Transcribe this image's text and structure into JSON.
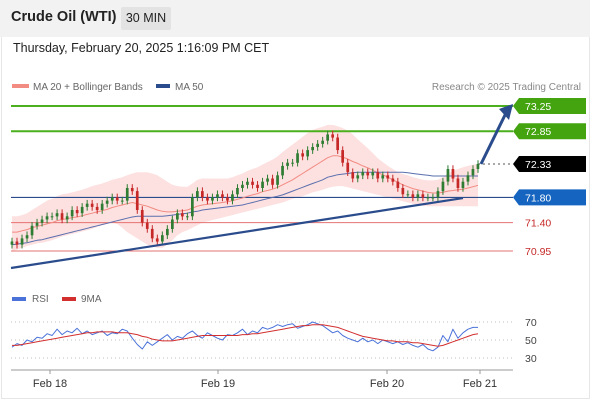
{
  "header": {
    "instrument": "Crude Oil (WTI)",
    "timeframe": "30 MIN",
    "timestamp": "Thursday, February 20, 2025 1:16:09 PM CET"
  },
  "legend": {
    "items": [
      {
        "label": "MA 20 + Bollinger Bands",
        "color": "#f28b82"
      },
      {
        "label": "MA 50",
        "color": "#2b4c8c"
      }
    ],
    "credit": "Research © 2025 Trading Central"
  },
  "colors": {
    "up": "#2e7d32",
    "down": "#c62828",
    "trend": "#2b4c8c",
    "resistance": "#4caf1e",
    "support": "#e57373",
    "pivot_bg": "#1565c0",
    "current_bg": "#000000",
    "bands": "#fcd6d6",
    "rsi": "#4a72d9",
    "rsi_ma": "#d32f2f"
  },
  "chart_data": [
    {
      "type": "candlestick",
      "title": "",
      "xlabel": "",
      "ylabel": "",
      "ylim": [
        70.7,
        73.4
      ],
      "x_ticks": [
        "Feb 18",
        "Feb 19",
        "Feb 20",
        "Feb 21"
      ],
      "grid": false,
      "levels": [
        {
          "label": "73.25",
          "value": 73.25,
          "kind": "resistance"
        },
        {
          "label": "72.85",
          "value": 72.85,
          "kind": "resistance"
        },
        {
          "label": "72.33",
          "value": 72.33,
          "kind": "current"
        },
        {
          "label": "71.80",
          "value": 71.8,
          "kind": "pivot"
        },
        {
          "label": "71.40",
          "value": 71.4,
          "kind": "support"
        },
        {
          "label": "70.95",
          "value": 70.95,
          "kind": "support"
        }
      ],
      "close_series": [
        71.1,
        71.05,
        71.15,
        71.2,
        71.35,
        71.4,
        71.45,
        71.5,
        71.5,
        71.55,
        71.45,
        71.5,
        71.6,
        71.55,
        71.65,
        71.7,
        71.65,
        71.6,
        71.7,
        71.75,
        71.8,
        71.75,
        71.75,
        71.95,
        71.9,
        71.6,
        71.4,
        71.3,
        71.15,
        71.1,
        71.2,
        71.3,
        71.45,
        71.55,
        71.5,
        71.5,
        71.8,
        71.9,
        71.8,
        71.75,
        71.8,
        71.85,
        71.8,
        71.75,
        71.85,
        71.95,
        72.0,
        72.05,
        72.0,
        71.95,
        72.05,
        72.1,
        72.0,
        72.15,
        72.3,
        72.35,
        72.35,
        72.5,
        72.45,
        72.55,
        72.6,
        72.65,
        72.7,
        72.8,
        72.75,
        72.55,
        72.35,
        72.2,
        72.1,
        72.15,
        72.2,
        72.15,
        72.2,
        72.1,
        72.15,
        72.1,
        72.05,
        71.95,
        71.85,
        71.85,
        71.8,
        71.85,
        71.8,
        71.8,
        71.8,
        71.9,
        72.05,
        72.25,
        72.1,
        71.95,
        72.05,
        72.15,
        72.25,
        72.33
      ],
      "ma20": [
        71.25,
        71.25,
        71.27,
        71.29,
        71.32,
        71.34,
        71.36,
        71.38,
        71.4,
        71.43,
        71.45,
        71.46,
        71.48,
        71.49,
        71.51,
        71.53,
        71.55,
        71.57,
        71.59,
        71.61,
        71.64,
        71.66,
        71.68,
        71.7,
        71.72,
        71.7,
        71.68,
        71.66,
        71.63,
        71.6,
        71.58,
        71.57,
        71.57,
        71.58,
        71.59,
        71.6,
        71.63,
        71.66,
        71.68,
        71.69,
        71.7,
        71.71,
        71.72,
        71.73,
        71.75,
        71.77,
        71.79,
        71.82,
        71.84,
        71.86,
        71.89,
        71.91,
        71.93,
        71.96,
        72.0,
        72.04,
        72.08,
        72.13,
        72.18,
        72.23,
        72.28,
        72.33,
        72.38,
        72.43,
        72.46,
        72.46,
        72.44,
        72.41,
        72.37,
        72.34,
        72.3,
        72.27,
        72.23,
        72.19,
        72.16,
        72.12,
        72.08,
        72.04,
        72.0,
        71.97,
        71.94,
        71.92,
        71.9,
        71.88,
        71.87,
        71.87,
        71.88,
        71.9,
        71.91,
        71.92,
        71.93,
        71.95,
        71.97,
        71.99
      ],
      "bb_upper": [
        71.5,
        71.5,
        71.52,
        71.55,
        71.6,
        71.65,
        71.7,
        71.75,
        71.78,
        71.82,
        71.85,
        71.86,
        71.88,
        71.9,
        71.92,
        71.95,
        71.98,
        72.0,
        72.02,
        72.05,
        72.08,
        72.1,
        72.12,
        72.15,
        72.18,
        72.2,
        72.2,
        72.2,
        72.18,
        72.15,
        72.1,
        72.05,
        72.0,
        71.98,
        71.97,
        71.97,
        72.02,
        72.08,
        72.1,
        72.1,
        72.1,
        72.1,
        72.1,
        72.1,
        72.12,
        72.15,
        72.18,
        72.22,
        72.25,
        72.28,
        72.32,
        72.36,
        72.4,
        72.45,
        72.52,
        72.58,
        72.64,
        72.7,
        72.76,
        72.82,
        72.87,
        72.9,
        72.92,
        72.95,
        72.95,
        72.93,
        72.9,
        72.86,
        72.8,
        72.72,
        72.65,
        72.58,
        72.5,
        72.42,
        72.36,
        72.3,
        72.25,
        72.2,
        72.17,
        72.15,
        72.12,
        72.1,
        72.08,
        72.07,
        72.07,
        72.08,
        72.12,
        72.18,
        72.22,
        72.25,
        72.28,
        72.3,
        72.32,
        72.33
      ],
      "bb_lower": [
        70.95,
        70.97,
        71.0,
        71.03,
        71.05,
        71.07,
        71.08,
        71.1,
        71.12,
        71.15,
        71.18,
        71.2,
        71.22,
        71.24,
        71.26,
        71.28,
        71.3,
        71.33,
        71.36,
        71.38,
        71.4,
        71.38,
        71.32,
        71.25,
        71.2,
        71.15,
        71.1,
        71.05,
        71.02,
        71.0,
        71.0,
        71.05,
        71.12,
        71.2,
        71.25,
        71.28,
        71.32,
        71.36,
        71.4,
        71.42,
        71.44,
        71.46,
        71.48,
        71.5,
        71.52,
        71.54,
        71.56,
        71.58,
        71.6,
        71.62,
        71.64,
        71.66,
        71.68,
        71.7,
        71.72,
        71.75,
        71.78,
        71.8,
        71.82,
        71.85,
        71.88,
        71.9,
        71.92,
        71.95,
        71.97,
        71.98,
        71.98,
        71.96,
        71.94,
        71.92,
        71.9,
        71.88,
        71.86,
        71.84,
        71.82,
        71.8,
        71.78,
        71.76,
        71.74,
        71.72,
        71.7,
        71.68,
        71.67,
        71.66,
        71.66,
        71.66,
        71.66,
        71.66,
        71.66,
        71.66,
        71.66,
        71.66,
        71.66,
        71.66
      ],
      "ma50": [
        71.05,
        71.06,
        71.07,
        71.08,
        71.1,
        71.12,
        71.13,
        71.15,
        71.17,
        71.19,
        71.21,
        71.23,
        71.25,
        71.27,
        71.29,
        71.31,
        71.33,
        71.35,
        71.37,
        71.39,
        71.41,
        71.43,
        71.45,
        71.47,
        71.49,
        71.5,
        71.5,
        71.5,
        71.5,
        71.5,
        71.5,
        71.51,
        71.52,
        71.53,
        71.54,
        71.55,
        71.57,
        71.58,
        71.6,
        71.61,
        71.62,
        71.63,
        71.64,
        71.65,
        71.66,
        71.67,
        71.68,
        71.7,
        71.72,
        71.74,
        71.76,
        71.78,
        71.8,
        71.82,
        71.84,
        71.87,
        71.9,
        71.93,
        71.96,
        71.99,
        72.02,
        72.05,
        72.08,
        72.12,
        72.14,
        72.16,
        72.17,
        72.18,
        72.19,
        72.2,
        72.2,
        72.2,
        72.2,
        72.2,
        72.2,
        72.2,
        72.2,
        72.2,
        72.2,
        72.19,
        72.18,
        72.17,
        72.16,
        72.15,
        72.14,
        72.14,
        72.14,
        72.14,
        72.14,
        72.14,
        72.14,
        72.14,
        72.14,
        72.14
      ],
      "trendline": {
        "from": 70.68,
        "to": 71.79
      },
      "forecast_arrow": {
        "from": 72.33,
        "to": 73.25
      }
    },
    {
      "type": "line",
      "title": "",
      "legend": [
        "RSI",
        "9MA"
      ],
      "ylim": [
        20,
        80
      ],
      "y_ticks": [
        70,
        50,
        30
      ],
      "series": [
        {
          "name": "RSI",
          "values": [
            42,
            46,
            44,
            50,
            48,
            53,
            52,
            57,
            55,
            62,
            56,
            60,
            58,
            63,
            57,
            60,
            56,
            58,
            60,
            55,
            58,
            57,
            62,
            60,
            52,
            45,
            40,
            48,
            44,
            48,
            52,
            56,
            50,
            54,
            52,
            57,
            60,
            55,
            52,
            58,
            55,
            52,
            50,
            56,
            55,
            58,
            62,
            56,
            60,
            58,
            64,
            62,
            64,
            67,
            65,
            67,
            68,
            63,
            65,
            67,
            70,
            68,
            66,
            62,
            58,
            60,
            55,
            52,
            50,
            48,
            52,
            48,
            50,
            46,
            50,
            48,
            46,
            48,
            45,
            47,
            44,
            42,
            45,
            40,
            38,
            42,
            55,
            48,
            62,
            52,
            58,
            62,
            64,
            64
          ]
        },
        {
          "name": "9MA",
          "values": [
            44,
            44,
            45,
            46,
            47,
            48,
            49,
            50,
            51,
            52,
            53,
            54,
            55,
            56,
            57,
            58,
            58,
            59,
            59,
            59,
            59,
            58,
            58,
            58,
            57,
            56,
            54,
            53,
            51,
            50,
            49,
            49,
            49,
            50,
            51,
            52,
            53,
            54,
            55,
            55,
            55,
            55,
            55,
            55,
            55,
            55,
            56,
            56,
            57,
            57,
            58,
            59,
            60,
            61,
            62,
            63,
            64,
            65,
            66,
            66,
            67,
            67,
            67,
            66,
            65,
            64,
            62,
            60,
            58,
            56,
            54,
            53,
            52,
            51,
            50,
            49,
            49,
            48,
            48,
            48,
            47,
            47,
            46,
            45,
            44,
            43,
            44,
            46,
            48,
            50,
            52,
            54,
            56,
            57
          ]
        }
      ]
    }
  ]
}
